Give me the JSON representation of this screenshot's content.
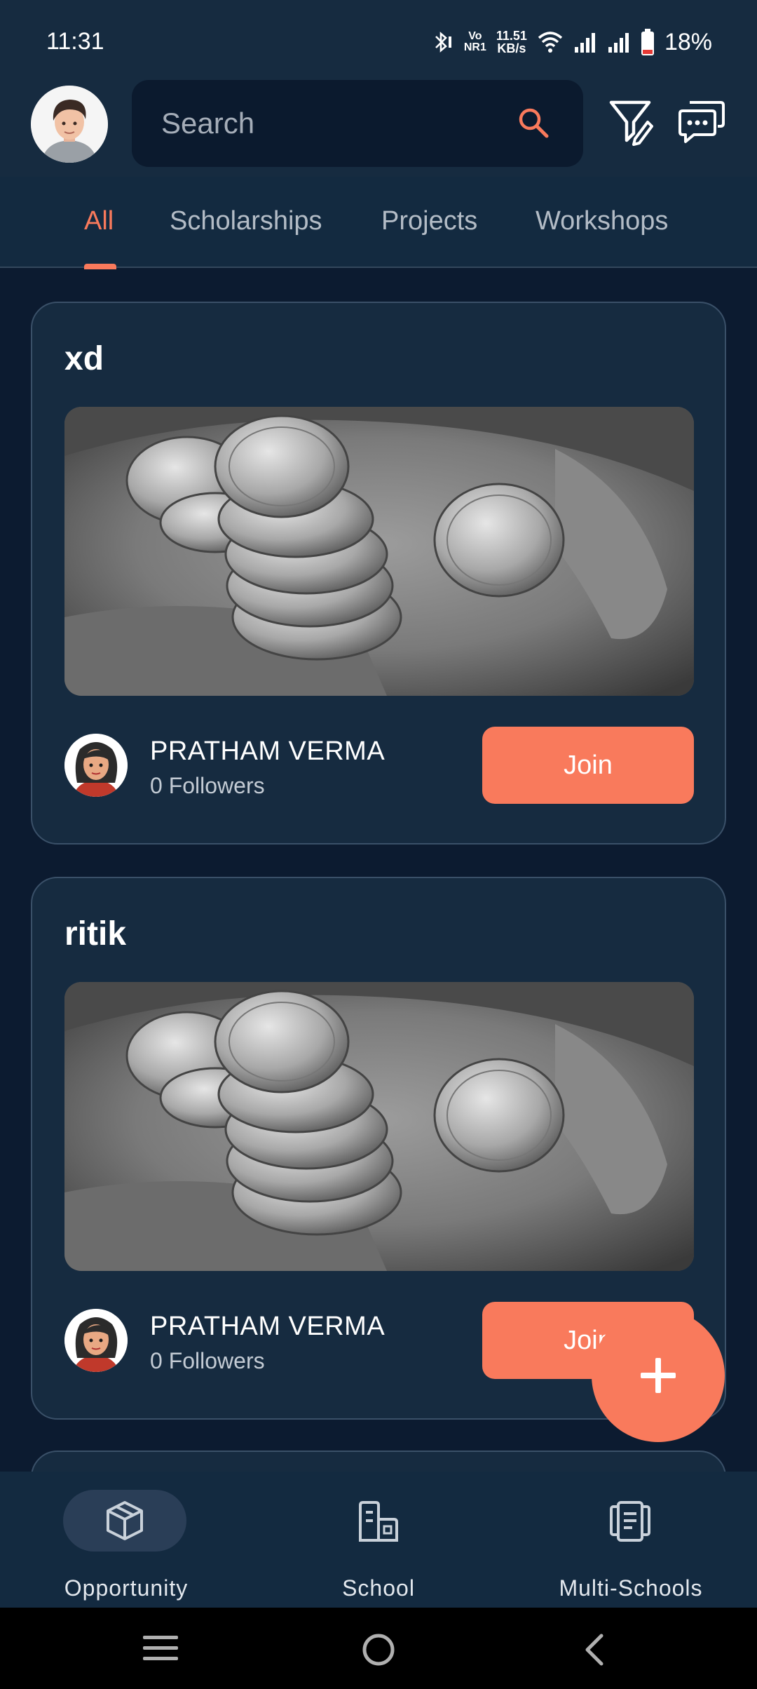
{
  "status_bar": {
    "time": "11:31",
    "volte": "Vo",
    "network": "NR1",
    "speed_value": "11.51",
    "speed_unit": "KB/s",
    "battery": "18%"
  },
  "header": {
    "search_placeholder": "Search",
    "icons": [
      "avatar",
      "search-icon",
      "filter-edit-icon",
      "chat-icon"
    ]
  },
  "tabs": [
    {
      "label": "All",
      "active": true
    },
    {
      "label": "Scholarships",
      "active": false
    },
    {
      "label": "Projects",
      "active": false
    },
    {
      "label": "Workshops",
      "active": false
    }
  ],
  "cards": [
    {
      "title": "xd",
      "author": "PRATHAM VERMA",
      "followers": "0 Followers",
      "action": "Join"
    },
    {
      "title": "ritik",
      "author": "PRATHAM VERMA",
      "followers": "0 Followers",
      "action": "Join"
    }
  ],
  "bottom_nav": [
    {
      "label": "Opportunity",
      "icon": "cube-icon",
      "active": true
    },
    {
      "label": "School",
      "icon": "school-icon",
      "active": false
    },
    {
      "label": "Multi-Schools",
      "icon": "documents-icon",
      "active": false
    }
  ],
  "colors": {
    "accent": "#f97a5c",
    "background": "#0c1b30",
    "card": "#162b40"
  }
}
